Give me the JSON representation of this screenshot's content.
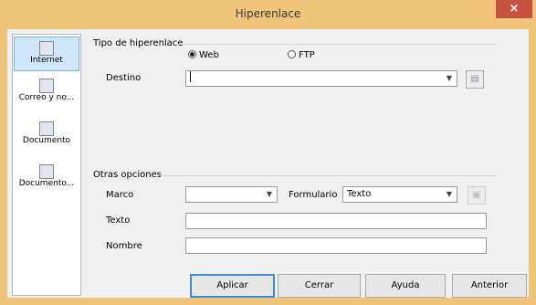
{
  "window": {
    "title": "Hiperenlace",
    "close_glyph": "×"
  },
  "sidebar": {
    "items": [
      {
        "label": "Internet",
        "icon": "globe-icon",
        "selected": true
      },
      {
        "label": "Correo y no...",
        "icon": "mail-icon",
        "selected": false
      },
      {
        "label": "Documento",
        "icon": "document-icon",
        "selected": false
      },
      {
        "label": "Documento...",
        "icon": "new-document-icon",
        "selected": false
      }
    ]
  },
  "hyperlink_type": {
    "group_label": "Tipo de hiperenlace",
    "options": [
      {
        "label": "Web",
        "selected": true
      },
      {
        "label": "FTP",
        "selected": false
      }
    ],
    "destination_label": "Destino",
    "destination_value": ""
  },
  "other_options": {
    "group_label": "Otras opciones",
    "frame_label": "Marco",
    "frame_value": "",
    "form_label": "Formulario",
    "form_value": "Texto",
    "text_label": "Texto",
    "text_value": "",
    "name_label": "Nombre",
    "name_value": ""
  },
  "buttons": {
    "apply": "Aplicar",
    "close": "Cerrar",
    "help": "Ayuda",
    "back": "Anterior"
  },
  "colors": {
    "titlebar": "#f0c47a",
    "close": "#c7503f",
    "accent": "#3b8ad9"
  }
}
